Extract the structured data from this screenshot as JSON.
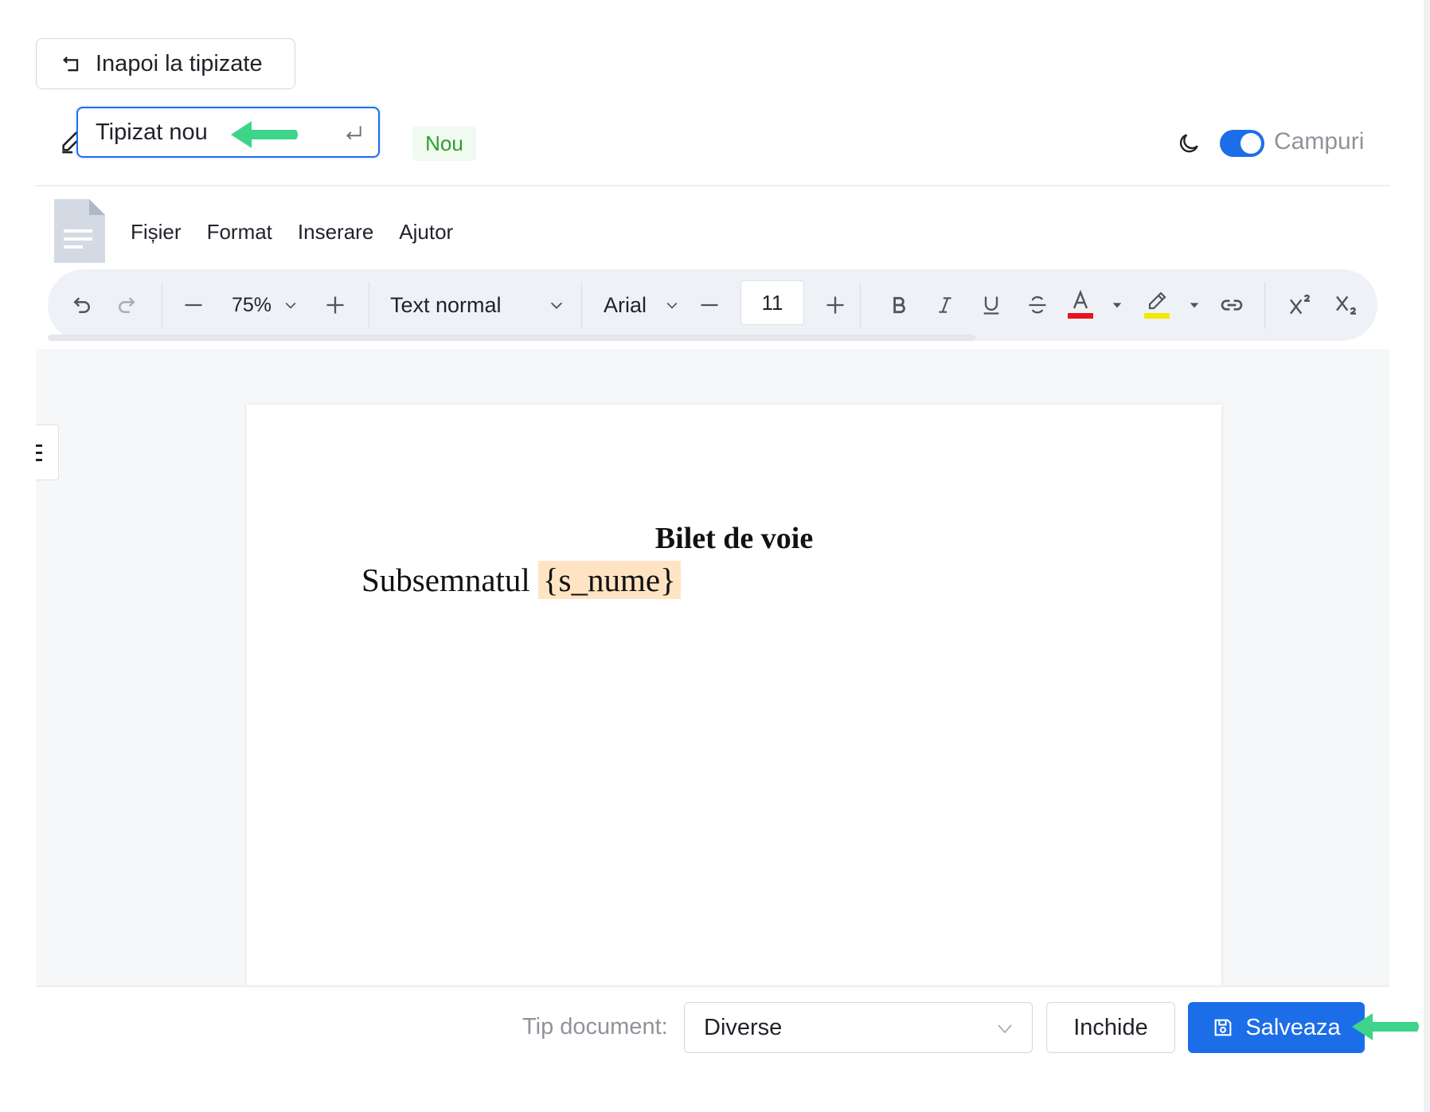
{
  "header": {
    "back_label": "Inapoi la tipizate",
    "title_value": "Tipizat nou",
    "status_badge": "Nou",
    "fields_toggle_label": "Campuri",
    "fields_toggle_on": true
  },
  "menu": {
    "items": [
      "Fișier",
      "Format",
      "Inserare",
      "Ajutor"
    ]
  },
  "toolbar": {
    "zoom": "75%",
    "paragraph_style": "Text normal",
    "font_family": "Arial",
    "font_size": "11",
    "text_color": "#e8141e",
    "highlight_color": "#f5e800"
  },
  "document": {
    "title": "Bilet de voie",
    "line_text": "Subsemnatul",
    "field_placeholder": "{s_nume}"
  },
  "footer": {
    "doc_type_label": "Tip document:",
    "doc_type_value": "Diverse",
    "close_label": "Inchide",
    "save_label": "Salveaza"
  },
  "colors": {
    "accent": "#1c6ee8",
    "badge_green": "#2e9e2e",
    "arrow_green": "#3ed489"
  }
}
